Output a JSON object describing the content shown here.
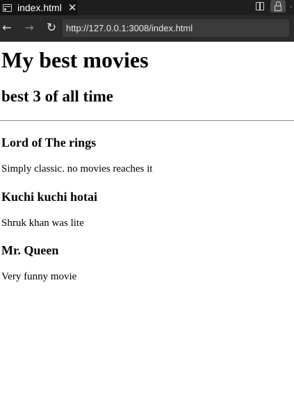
{
  "tab": {
    "title": "index.html",
    "close_glyph": "✕",
    "icon": "page-preview-icon"
  },
  "window_controls": {
    "split_icon": "split-editor-icon",
    "lock_icon": "lock-icon",
    "more_glyph": "·"
  },
  "nav": {
    "back_glyph": "←",
    "forward_glyph": "→",
    "reload_glyph": "↻",
    "url": "http://127.0.0.1:3008/index.html"
  },
  "page": {
    "heading": "My best movies",
    "subheading": "best 3 of all time",
    "movies": [
      {
        "title": "Lord of The rings",
        "description": "Simply classic. no movies reaches it"
      },
      {
        "title": "Kuchi kuchi hotai",
        "description": "Shruk khan was lite"
      },
      {
        "title": "Mr. Queen",
        "description": "Very funny movie"
      }
    ]
  },
  "colors": {
    "tabbar_bg": "#1f1f1f",
    "navbar_bg": "#2a2a2a",
    "url_bg": "#3b3b3b",
    "page_bg": "#ffffff",
    "text": "#000000"
  }
}
